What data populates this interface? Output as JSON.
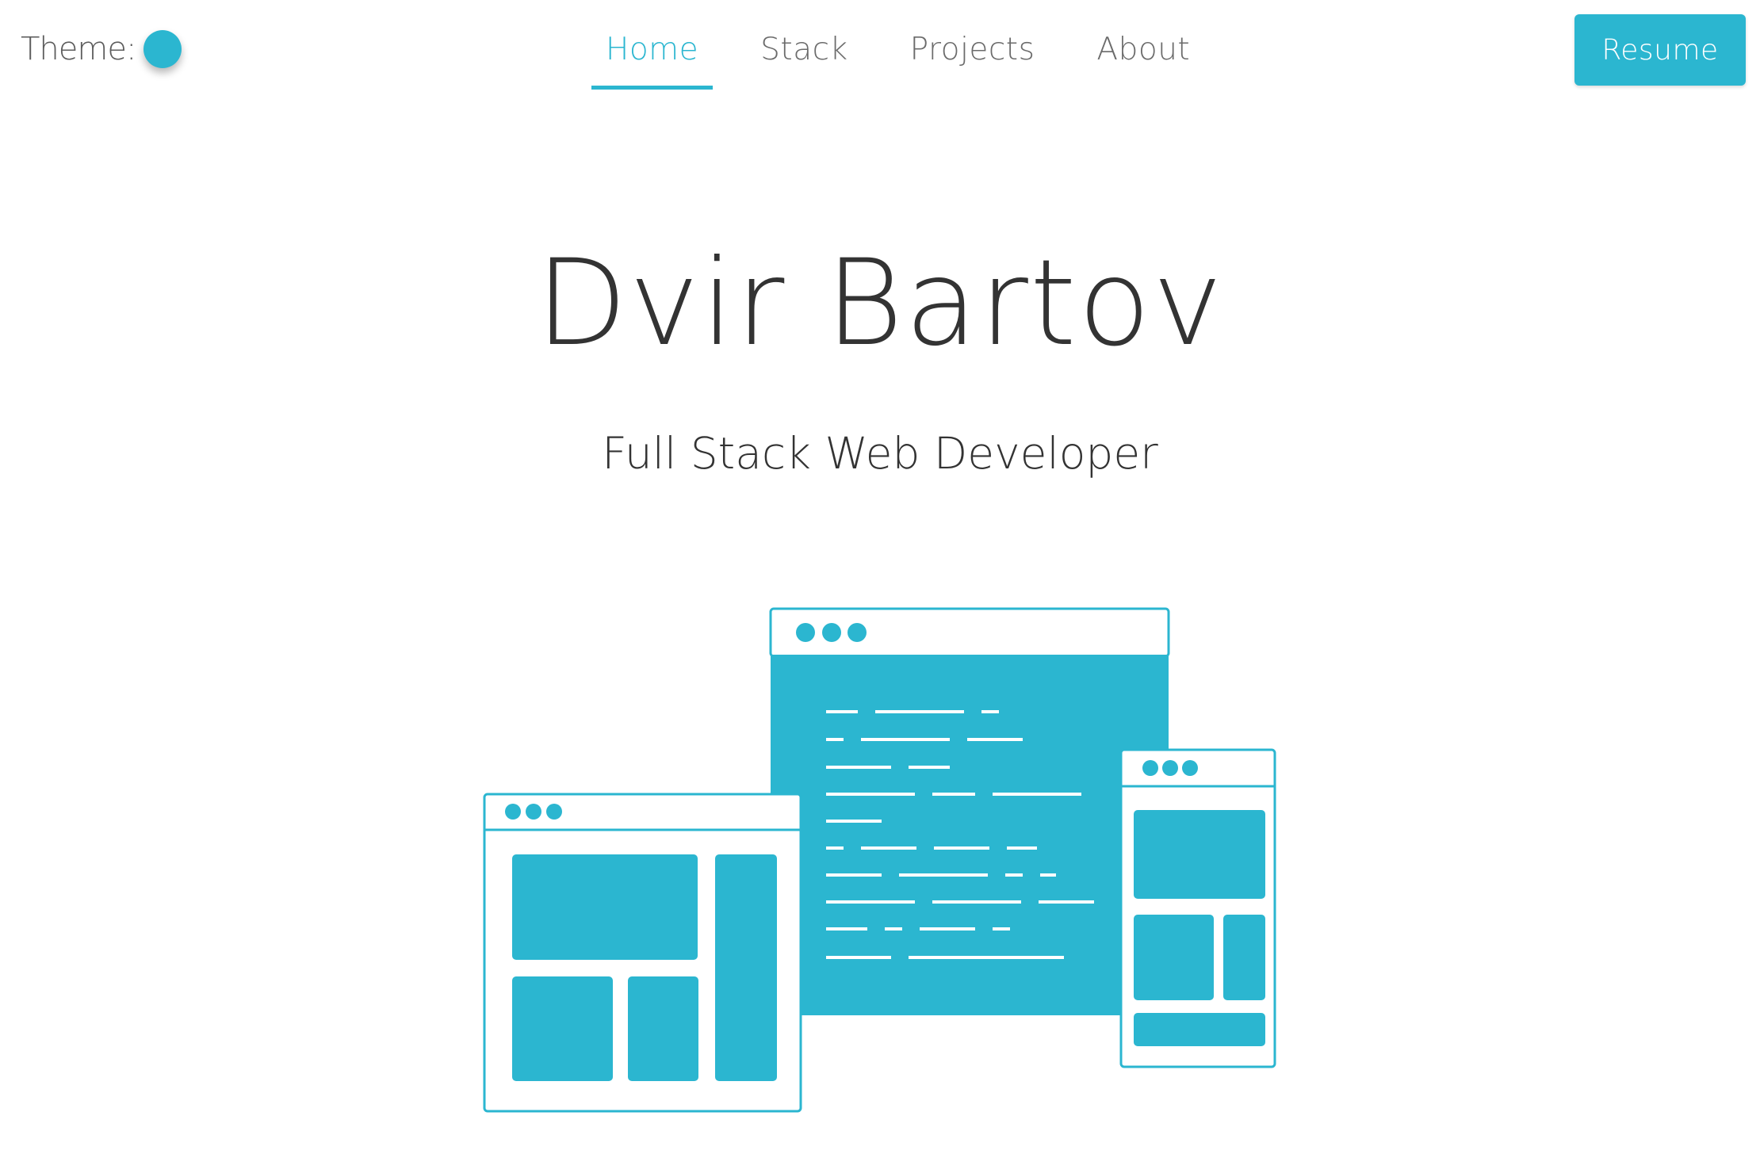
{
  "theme": {
    "label": "Theme:",
    "accent_color": "#2bb6d0"
  },
  "nav": {
    "items": [
      {
        "label": "Home",
        "active": true
      },
      {
        "label": "Stack",
        "active": false
      },
      {
        "label": "Projects",
        "active": false
      },
      {
        "label": "About",
        "active": false
      }
    ]
  },
  "header": {
    "resume_label": "Resume"
  },
  "hero": {
    "name": "Dvir Bartov",
    "subtitle": "Full Stack Web Developer",
    "illustration": "browser-windows-illustration"
  }
}
